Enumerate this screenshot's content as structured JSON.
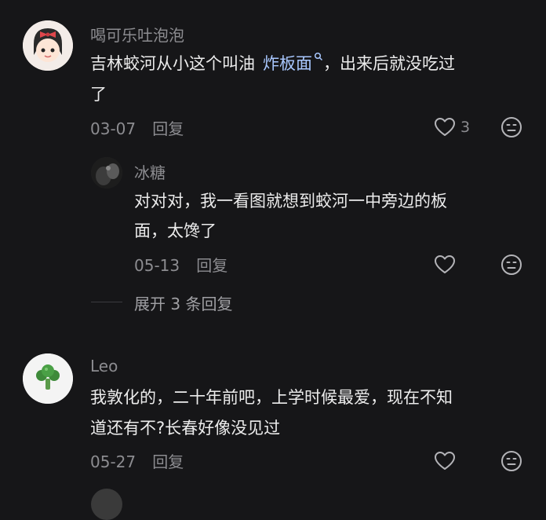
{
  "comments": [
    {
      "username": "喝可乐吐泡泡",
      "text_before": "吉林蛟河从小这个叫油",
      "keyword": "炸板面",
      "keyword_icon": "search-icon",
      "text_after": "，出来后就没吃过",
      "text_line2": "了",
      "date": "03-07",
      "reply_label": "回复",
      "likes": "3",
      "reply": {
        "username": "冰糖",
        "text_line1": "对对对，我一看图就想到蛟河一中旁边的板",
        "text_line2": "面，太馋了",
        "date": "05-13",
        "reply_label": "回复"
      },
      "expand_label": "展开 3 条回复"
    },
    {
      "username": "Leo",
      "text_line1": "我敦化的，二十年前吧，上学时候最爱，现在不知",
      "text_line2": "道还有不?长春好像没见过",
      "date": "05-27",
      "reply_label": "回复"
    }
  ],
  "icons": {
    "like": "heart-icon",
    "dislike": "neutral-face-icon"
  },
  "colors": {
    "background": "#161618",
    "keyword": "#a9c8ff",
    "muted": "#8c8c90"
  }
}
